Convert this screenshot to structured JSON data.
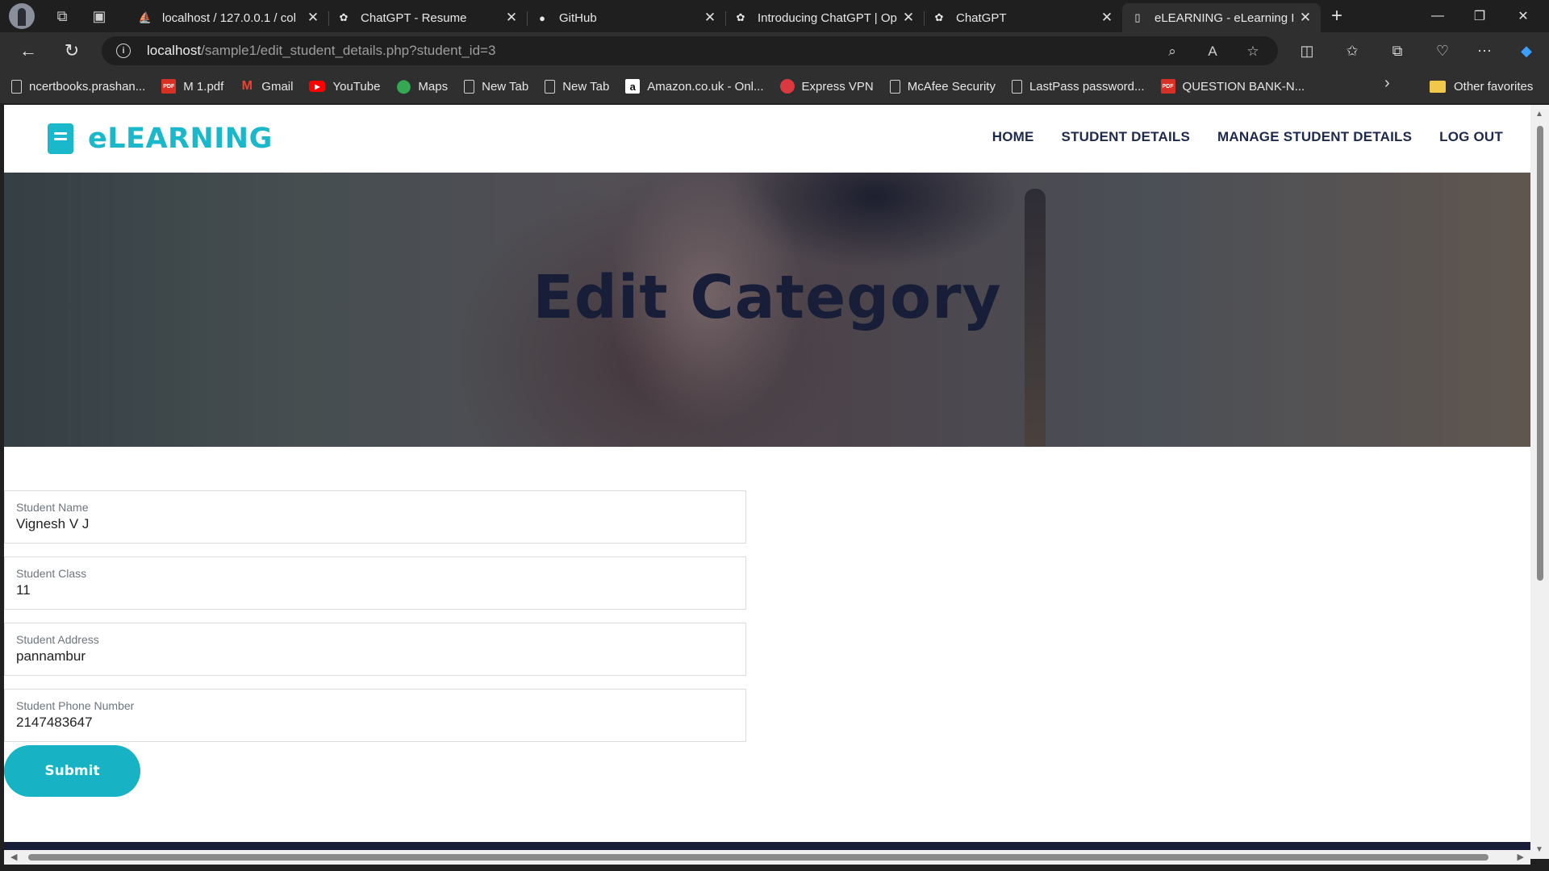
{
  "browser": {
    "tabs": [
      {
        "title": "localhost / 127.0.0.1 / col",
        "icon": "phpmyadmin-icon"
      },
      {
        "title": "ChatGPT - Resume",
        "icon": "openai-icon"
      },
      {
        "title": "GitHub",
        "icon": "github-icon"
      },
      {
        "title": "Introducing ChatGPT | Op",
        "icon": "openai-icon"
      },
      {
        "title": "ChatGPT",
        "icon": "openai-icon"
      },
      {
        "title": "eLEARNING - eLearning I",
        "icon": "page-icon"
      }
    ],
    "url_host": "localhost",
    "url_path": "/sample1/edit_student_details.php?student_id=3",
    "bookmarks": [
      {
        "label": "ncertbooks.prashan...",
        "icon": "page"
      },
      {
        "label": "M 1.pdf",
        "icon": "pdf"
      },
      {
        "label": "Gmail",
        "icon": "gmail"
      },
      {
        "label": "YouTube",
        "icon": "youtube"
      },
      {
        "label": "Maps",
        "icon": "maps"
      },
      {
        "label": "New Tab",
        "icon": "page"
      },
      {
        "label": "New Tab",
        "icon": "page"
      },
      {
        "label": "Amazon.co.uk - Onl...",
        "icon": "amazon"
      },
      {
        "label": "Express VPN",
        "icon": "vpn"
      },
      {
        "label": "McAfee Security",
        "icon": "page"
      },
      {
        "label": "LastPass password...",
        "icon": "page"
      },
      {
        "label": "QUESTION BANK-N...",
        "icon": "pdf"
      }
    ],
    "other_favorites": "Other favorites"
  },
  "site": {
    "brand": "eLEARNING",
    "brand_color": "#1bb8cc",
    "nav": [
      "HOME",
      "STUDENT DETAILS",
      "MANAGE STUDENT DETAILS",
      "LOG OUT"
    ],
    "hero_title": "Edit Category",
    "form": {
      "fields": [
        {
          "label": "Student Name",
          "value": "Vignesh V J"
        },
        {
          "label": "Student Class",
          "value": "11"
        },
        {
          "label": "Student Address",
          "value": "pannambur"
        },
        {
          "label": "Student Phone Number",
          "value": "2147483647"
        }
      ],
      "submit_label": "Submit"
    }
  }
}
